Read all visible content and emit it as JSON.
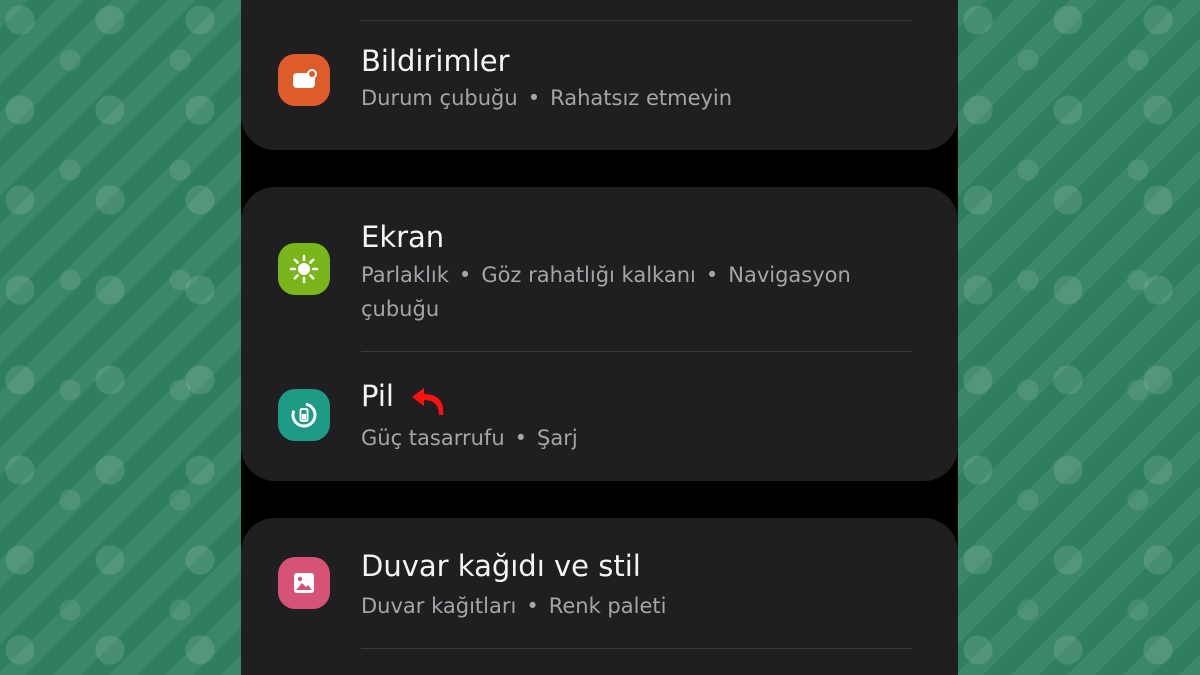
{
  "colors": {
    "background": "#2f7f5f",
    "panel": "#000000",
    "card": "#1f1f21",
    "title": "#f4f4f5",
    "subtitle": "#a5a5a8",
    "icon_notifications": "#de5b2a",
    "icon_display": "#79b51b",
    "icon_battery": "#1f9a84",
    "icon_wallpaper": "#d75375",
    "arrow": "#ff1010"
  },
  "settings": {
    "notifications": {
      "title": "Bildirimler",
      "subtitle": {
        "item1": "Durum çubuğu",
        "item2": "Rahatsız etmeyin"
      },
      "icon": "notifications-icon"
    },
    "display": {
      "title": "Ekran",
      "subtitle": {
        "item1": "Parlaklık",
        "item2": "Göz rahatlığı kalkanı",
        "item3": "Navigasyon çubuğu"
      },
      "icon": "brightness-icon"
    },
    "battery": {
      "title": "Pil",
      "subtitle": {
        "item1": "Güç tasarrufu",
        "item2": "Şarj"
      },
      "icon": "battery-icon",
      "annotation": "red-return-arrow-icon"
    },
    "wallpaper": {
      "title": "Duvar kağıdı ve stil",
      "subtitle": {
        "item1": "Duvar kağıtları",
        "item2": "Renk paleti"
      },
      "icon": "wallpaper-icon"
    }
  }
}
